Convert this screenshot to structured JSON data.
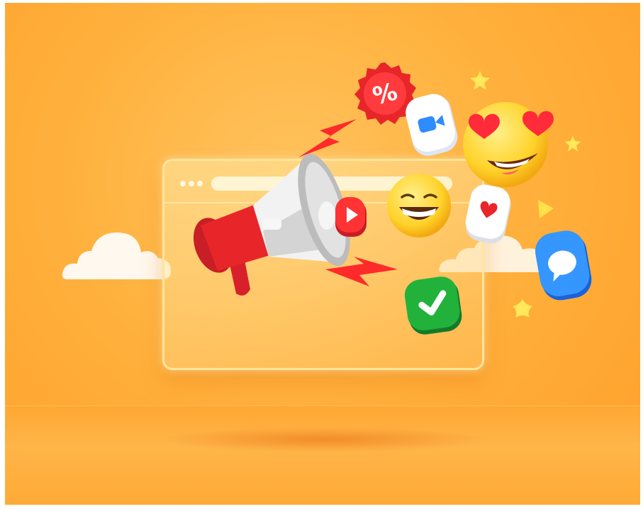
{
  "scene": {
    "background_color": "#ffb13d",
    "floor_color": "#ffa733",
    "accent_red": "#e8262a",
    "accent_blue": "#2f8cff",
    "accent_green": "#1fae3a",
    "emoji_yellow": "#ffcc22"
  },
  "badge": {
    "text": "%"
  },
  "icons": [
    "megaphone-icon",
    "percent-badge-icon",
    "video-camera-icon",
    "heart-eyes-emoji-icon",
    "grinning-emoji-icon",
    "heart-icon",
    "play-button-icon",
    "chat-bubble-icon",
    "checkmark-icon",
    "lightning-bolt-icon",
    "star-icon",
    "cloud-icon",
    "browser-window-icon"
  ]
}
